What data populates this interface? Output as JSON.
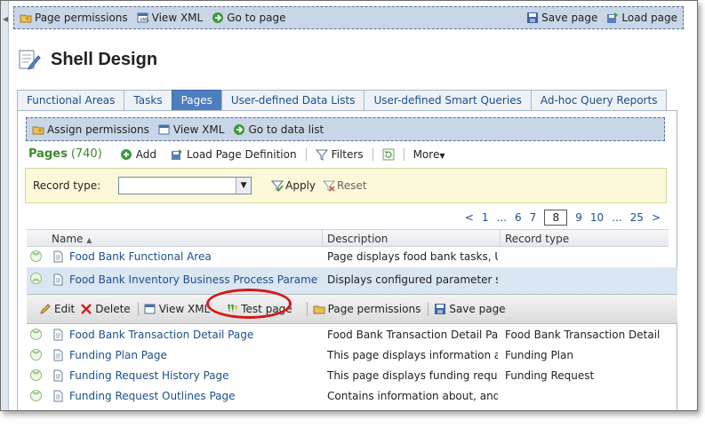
{
  "top_toolbar": {
    "page_permissions": "Page permissions",
    "view_xml": "View XML",
    "go_to_page": "Go to page",
    "save_page": "Save page",
    "load_page": "Load page"
  },
  "header": {
    "title": "Shell Design"
  },
  "tabs": [
    {
      "label": "Functional Areas",
      "active": false
    },
    {
      "label": "Tasks",
      "active": false
    },
    {
      "label": "Pages",
      "active": true
    },
    {
      "label": "User-defined Data Lists",
      "active": false
    },
    {
      "label": "User-defined Smart Queries",
      "active": false
    },
    {
      "label": "Ad-hoc Query Reports",
      "active": false
    }
  ],
  "panel_toolbar": {
    "assign_permissions": "Assign permissions",
    "view_xml": "View XML",
    "go_to_data_list": "Go to data list"
  },
  "list_toolbar": {
    "title": "Pages",
    "count": "(740)",
    "add": "Add",
    "load_definition": "Load Page Definition",
    "filters": "Filters",
    "more": "More"
  },
  "filter": {
    "record_type_label": "Record type:",
    "record_type_value": "",
    "apply": "Apply",
    "reset": "Reset"
  },
  "pager": {
    "prev": "<",
    "p1": "1",
    "ellipsis": "...",
    "p6": "6",
    "p7": "7",
    "current": "8",
    "p9": "9",
    "p10": "10",
    "ellipsis2": "...",
    "p25": "25",
    "next": ">"
  },
  "columns": {
    "name": "Name",
    "description": "Description",
    "record_type": "Record type"
  },
  "rows": [
    {
      "name": "Food Bank Functional Area",
      "description": "Page displays food bank tasks, UI ...",
      "record_type": ""
    },
    {
      "name": "Food Bank Inventory Business Process Parameter S...",
      "description": "Displays configured parameter set...",
      "record_type": ""
    },
    {
      "name": "Food Bank Transaction Detail Page",
      "description": "Food Bank Transaction Detail Page",
      "record_type": "Food Bank Transaction Detail"
    },
    {
      "name": "Funding Plan Page",
      "description": "This page displays information ab...",
      "record_type": "Funding Plan"
    },
    {
      "name": "Funding Request History Page",
      "description": "This page displays funding reques...",
      "record_type": "Funding Request"
    },
    {
      "name": "Funding Request Outlines Page",
      "description": "Contains information about, and ...",
      "record_type": ""
    }
  ],
  "row_actions": {
    "edit": "Edit",
    "delete": "Delete",
    "view_xml": "View XML",
    "test_page": "Test page",
    "page_permissions": "Page permissions",
    "save_page": "Save page"
  },
  "colors": {
    "accent": "#4d7fc0",
    "toolbar_bg": "#c9d6e8",
    "highlight": "#d21a1a",
    "pages_green": "#3c8a2e"
  }
}
